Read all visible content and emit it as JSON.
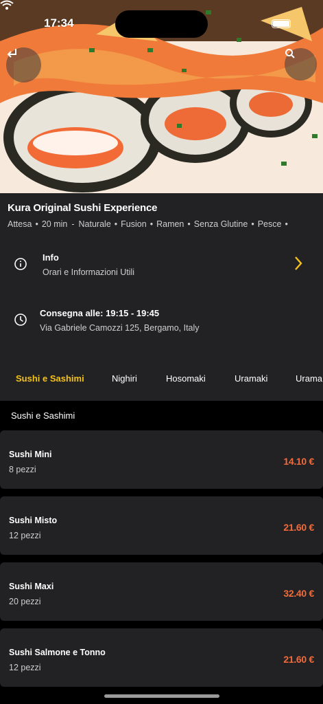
{
  "status_bar": {
    "time": "17:34"
  },
  "restaurant": {
    "name": "Kura Original Sushi Experience",
    "wait_label": "Attesa",
    "wait_time": "20 min",
    "tags": [
      "Naturale",
      "Fusion",
      "Ramen",
      "Senza Glutine",
      "Pesce"
    ]
  },
  "info_row": {
    "title": "Info",
    "subtitle": "Orari e Informazioni Utili"
  },
  "delivery_row": {
    "title": "Consegna alle: 19:15 - 19:45",
    "address": "Via Gabriele Camozzi 125, Bergamo, Italy"
  },
  "tabs": [
    "Sushi e Sashimi",
    "Nighiri",
    "Hosomaki",
    "Uramaki",
    "Urama"
  ],
  "section_title": "Sushi e Sashimi",
  "menu_items": [
    {
      "name": "Sushi Mini",
      "description": "8 pezzi",
      "price": "14.10 €"
    },
    {
      "name": "Sushi Misto",
      "description": "12 pezzi",
      "price": "21.60 €"
    },
    {
      "name": "Sushi Maxi",
      "description": "20 pezzi",
      "price": "32.40 €"
    },
    {
      "name": "Sushi Salmone e Tonno",
      "description": "12 pezzi",
      "price": "21.60 €"
    }
  ],
  "colors": {
    "accent": "#f5c21b",
    "price": "#f26b3a",
    "panel": "#222224",
    "background": "#000000"
  },
  "icons": {
    "back": "return-arrow-icon",
    "search": "search-icon",
    "info": "info-circle-icon",
    "clock": "clock-icon",
    "chevron": "chevron-right-icon"
  }
}
